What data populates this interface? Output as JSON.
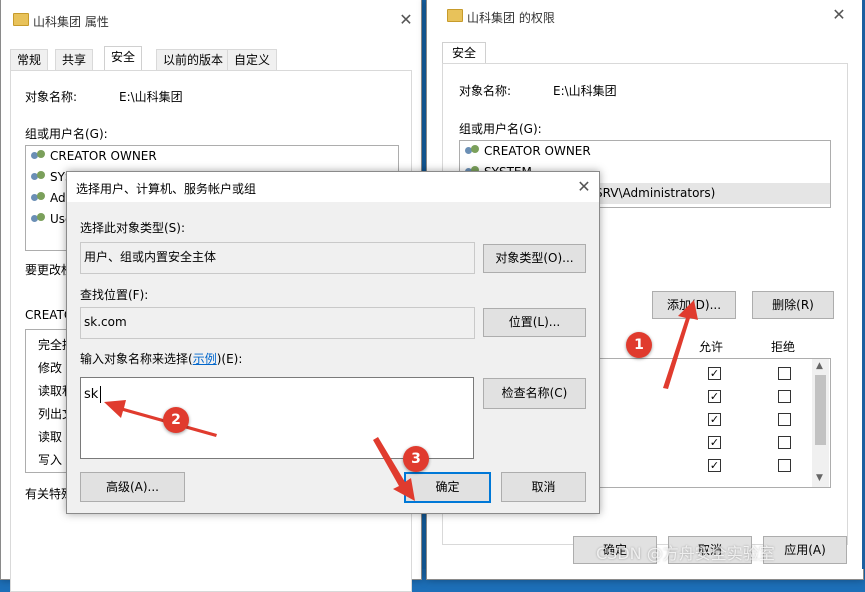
{
  "properties_window": {
    "title": "山科集团 属性",
    "tabs": [
      "常规",
      "共享",
      "安全",
      "以前的版本",
      "自定义"
    ],
    "active_tab": "安全",
    "object_name_label": "对象名称:",
    "object_name_value": "E:\\山科集团",
    "group_users_label": "组或用户名(G):",
    "users": [
      "CREATOR OWNER",
      "SYS",
      "Adr",
      "Use"
    ],
    "change_text": "要更改权",
    "perm_header": "CREATO",
    "permissions": [
      "完全控",
      "修改",
      "读取和",
      "列出文",
      "读取",
      "写入"
    ],
    "special_text": "有关特殊"
  },
  "permissions_window": {
    "title": "山科集团 的权限",
    "tab": "安全",
    "object_name_label": "对象名称:",
    "object_name_value": "E:\\山科集团",
    "group_users_label": "组或用户名(G):",
    "users": [
      "CREATOR OWNER",
      "SYSTEM",
      "SRV\\Administrators)"
    ],
    "add_button": "添加(D)...",
    "remove_button": "删除(R)",
    "allow_header": "允许",
    "deny_header": "拒绝",
    "allow_checked": [
      true,
      true,
      true,
      true,
      true
    ],
    "bottom_buttons": [
      "确定",
      "取消",
      "应用(A)"
    ]
  },
  "select_dialog": {
    "title": "选择用户、计算机、服务帐户或组",
    "object_type_label": "选择此对象类型(S):",
    "object_type_value": "用户、组或内置安全主体",
    "object_type_button": "对象类型(O)...",
    "location_label": "查找位置(F):",
    "location_value": "sk.com",
    "location_button": "位置(L)...",
    "enter_label_prefix": "输入对象名称来选择(",
    "enter_label_link": "示例",
    "enter_label_suffix": ")(E):",
    "enter_value": "sk",
    "check_names_button": "检查名称(C)",
    "advanced_button": "高级(A)...",
    "ok_button": "确定",
    "cancel_button": "取消"
  },
  "annotations": {
    "badge1": "1",
    "badge2": "2",
    "badge3": "3",
    "arrow_color": "#e03b2e"
  },
  "watermark": "CSDN @方舟安全实验室"
}
